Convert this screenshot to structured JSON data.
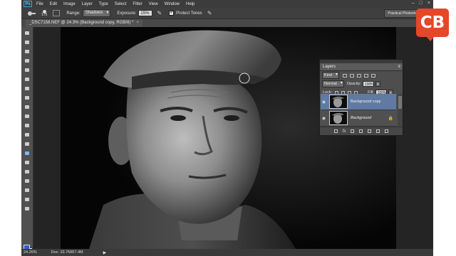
{
  "app": {
    "logo_text": "Ps",
    "menu": [
      "File",
      "Edit",
      "Image",
      "Layer",
      "Type",
      "Select",
      "Filter",
      "View",
      "Window",
      "Help"
    ],
    "window_controls": [
      "–",
      "□",
      "×"
    ]
  },
  "options_bar": {
    "brush_size": "175",
    "range_label": "Range:",
    "range_value": "Shadows",
    "exposure_label": "Exposure:",
    "exposure_value": "15%",
    "protect_tones_label": "Protect Tones",
    "protect_tones_checked": true,
    "workspace": "Practical Photoshop start"
  },
  "document": {
    "tab_title": "_DSC7158.NEF @ 24.3% (Background copy, RGB/8) *",
    "close_glyph": "×"
  },
  "toolbox": {
    "tool_icons": [
      "move-icon",
      "marquee-icon",
      "lasso-icon",
      "quick-select-icon",
      "crop-icon",
      "eyedropper-icon",
      "healing-icon",
      "brush-icon",
      "clone-stamp-icon",
      "history-brush-icon",
      "eraser-icon",
      "gradient-icon",
      "blur-icon",
      "dodge-icon",
      "pen-icon",
      "type-icon",
      "path-select-icon",
      "shape-icon",
      "hand-icon",
      "zoom-icon"
    ],
    "selected_tool": "dodge-icon",
    "foreground_color": "#2a62c9",
    "background_color": "#ffffff"
  },
  "status_bar": {
    "zoom": "24.26%",
    "doc_size": "Doc: 33.7M/67.4M",
    "arrow": "▶"
  },
  "layers_panel": {
    "title": "Layers",
    "menu_glyph": "≡",
    "filter_kind": "Kind",
    "blend_mode": "Normal",
    "opacity_label": "Opacity:",
    "opacity_value": "100%",
    "lock_label": "Lock:",
    "fill_label": "Fill:",
    "fill_value": "100%",
    "layers": [
      {
        "name": "Background copy",
        "active": true,
        "visible": true,
        "locked": false
      },
      {
        "name": "Background",
        "active": false,
        "visible": true,
        "locked": true
      }
    ],
    "bottom_icons": [
      "link-icon",
      "fx-icon",
      "mask-icon",
      "adjustment-icon",
      "group-icon",
      "new-layer-icon",
      "trash-icon"
    ],
    "fx_text": "fx"
  },
  "brand_badge": {
    "text": "CB",
    "color": "#e4472a"
  }
}
